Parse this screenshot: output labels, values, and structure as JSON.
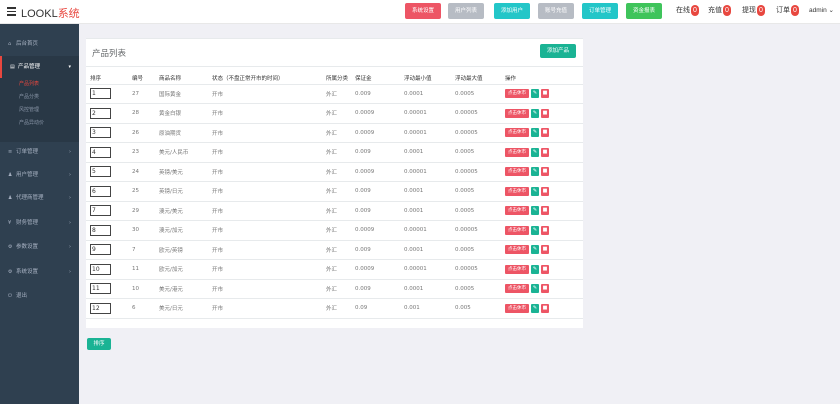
{
  "brand": {
    "main": "LOOKL",
    "accent": "系统"
  },
  "topbar": {
    "buttons": [
      {
        "label": "系统设置",
        "color": "#ed5565"
      },
      {
        "label": "用户列表",
        "color": "#b7bcc4"
      },
      {
        "label": "添加用户",
        "color": "#23c6c8"
      },
      {
        "label": "账号充值",
        "color": "#b7bcc4"
      },
      {
        "label": "订单管理",
        "color": "#23c6c8"
      },
      {
        "label": "资金报表",
        "color": "#3fc45b"
      }
    ],
    "counters": [
      {
        "label": "在线",
        "value": "0"
      },
      {
        "label": "充值",
        "value": "0"
      },
      {
        "label": "提现",
        "value": "0"
      },
      {
        "label": "订单",
        "value": "0"
      }
    ],
    "admin": "admin ⌄"
  },
  "sidebar": {
    "items": [
      {
        "label": "后台首页",
        "icon": "home-icon",
        "glyph": "⌂"
      },
      {
        "label": "产品管理",
        "icon": "box-icon",
        "glyph": "▤",
        "active": true
      },
      {
        "label": "订单管理",
        "icon": "order-icon",
        "glyph": "≡"
      },
      {
        "label": "用户管理",
        "icon": "user-icon",
        "glyph": "♟"
      },
      {
        "label": "代理商管理",
        "icon": "agent-icon",
        "glyph": "♟"
      },
      {
        "label": "财务管理",
        "icon": "finance-icon",
        "glyph": "¥"
      },
      {
        "label": "参数设置",
        "icon": "settings-icon",
        "glyph": "⚙"
      },
      {
        "label": "系统设置",
        "icon": "gear-icon",
        "glyph": "⚙"
      },
      {
        "label": "退出",
        "icon": "logout-icon",
        "glyph": "⏻"
      }
    ],
    "subitems": [
      {
        "label": "产品列表",
        "active": true
      },
      {
        "label": "产品分类"
      },
      {
        "label": "风控管理"
      },
      {
        "label": "产品异动价"
      }
    ]
  },
  "panel": {
    "title": "产品列表",
    "add_label": "添加产品",
    "columns": [
      "排序",
      "编号",
      "商品名称",
      "状态（不盘正常开市的时间）",
      "所属分类",
      "保证金",
      "浮动最小值",
      "浮动最大值",
      "操作"
    ],
    "rows": [
      {
        "sort": "1",
        "id": "27",
        "name": "国际黄金",
        "status": "开市",
        "category": "外汇",
        "deposit": "0.009",
        "min": "0.0001",
        "max": "0.0005"
      },
      {
        "sort": "2",
        "id": "28",
        "name": "黄金白银",
        "status": "开市",
        "category": "外汇",
        "deposit": "0.0009",
        "min": "0.00001",
        "max": "0.00005"
      },
      {
        "sort": "3",
        "id": "26",
        "name": "原油期货",
        "status": "开市",
        "category": "外汇",
        "deposit": "0.0009",
        "min": "0.00001",
        "max": "0.00005"
      },
      {
        "sort": "4",
        "id": "23",
        "name": "美元/人民币",
        "status": "开市",
        "category": "外汇",
        "deposit": "0.009",
        "min": "0.0001",
        "max": "0.0005"
      },
      {
        "sort": "5",
        "id": "24",
        "name": "英镑/美元",
        "status": "开市",
        "category": "外汇",
        "deposit": "0.0009",
        "min": "0.00001",
        "max": "0.00005"
      },
      {
        "sort": "6",
        "id": "25",
        "name": "英镑/日元",
        "status": "开市",
        "category": "外汇",
        "deposit": "0.009",
        "min": "0.0001",
        "max": "0.0005"
      },
      {
        "sort": "7",
        "id": "29",
        "name": "澳元/美元",
        "status": "开市",
        "category": "外汇",
        "deposit": "0.009",
        "min": "0.0001",
        "max": "0.0005"
      },
      {
        "sort": "8",
        "id": "30",
        "name": "澳元/加元",
        "status": "开市",
        "category": "外汇",
        "deposit": "0.0009",
        "min": "0.00001",
        "max": "0.00005"
      },
      {
        "sort": "9",
        "id": "7",
        "name": "欧元/英镑",
        "status": "开市",
        "category": "外汇",
        "deposit": "0.009",
        "min": "0.0001",
        "max": "0.0005"
      },
      {
        "sort": "10",
        "id": "11",
        "name": "欧元/加元",
        "status": "开市",
        "category": "外汇",
        "deposit": "0.0009",
        "min": "0.00001",
        "max": "0.00005"
      },
      {
        "sort": "11",
        "id": "10",
        "name": "美元/港元",
        "status": "开市",
        "category": "外汇",
        "deposit": "0.009",
        "min": "0.0001",
        "max": "0.0005"
      },
      {
        "sort": "12",
        "id": "6",
        "name": "美元/日元",
        "status": "开市",
        "category": "外汇",
        "deposit": "0.09",
        "min": "0.001",
        "max": "0.005"
      }
    ],
    "action_label": "点击休市",
    "edit_icon": "pencil-icon",
    "delete_icon": "trash-icon"
  },
  "sort_button": "排序"
}
